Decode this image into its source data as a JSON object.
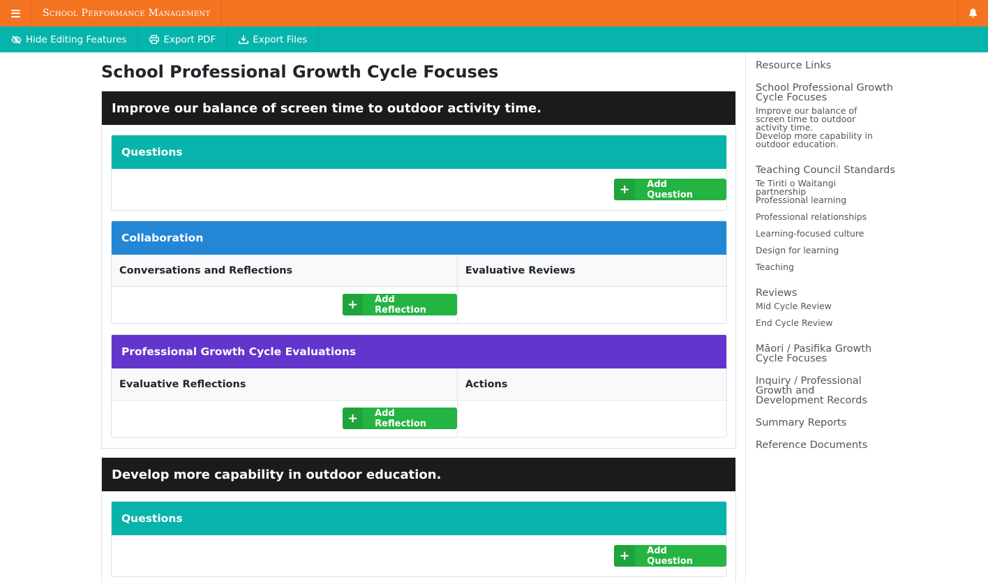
{
  "app": {
    "title": "School Performance Management"
  },
  "toolbar": {
    "hide_editing": "Hide Editing Features",
    "export_pdf": "Export PDF",
    "export_files": "Export Files"
  },
  "page": {
    "title": "School Professional Growth Cycle Focuses"
  },
  "focuses": [
    {
      "title": "Improve our balance of screen time to outdoor activity time.",
      "questions": {
        "header": "Questions",
        "button": "Add Question"
      },
      "collaboration": {
        "header": "Collaboration",
        "left_col": "Conversations and Reflections",
        "right_col": "Evaluative Reviews",
        "button": "Add Reflection"
      },
      "evaluations": {
        "header": "Professional Growth Cycle Evaluations",
        "left_col": "Evaluative Reflections",
        "right_col": "Actions",
        "button": "Add Reflection"
      }
    },
    {
      "title": "Develop more capability in outdoor education.",
      "questions": {
        "header": "Questions",
        "button": "Add Question"
      }
    }
  ],
  "sidebar": {
    "resource_links": "Resource Links",
    "growth_focuses": "School Professional Growth Cycle Focuses",
    "focus_1": "Improve our balance of screen time to outdoor activity time.",
    "focus_2": "Develop more capability in outdoor education.",
    "standards": "Teaching Council Standards",
    "standards_items": [
      "Te Tiriti o Waitangi partnership",
      "Professional learning",
      "Professional relationships",
      "Learning-focused culture",
      "Design for learning",
      "Teaching"
    ],
    "reviews": "Reviews",
    "reviews_items": [
      "Mid Cycle Review",
      "End Cycle Review"
    ],
    "maori_pasifika": "Māori / Pasifika Growth Cycle Focuses",
    "inquiry": "Inquiry / Professional Growth and Development Records",
    "summary": "Summary Reports",
    "reference": "Reference Documents"
  },
  "icons": {
    "menu": "hamburger-icon",
    "bell": "bell-icon",
    "hide": "eye-slash-icon",
    "pdf": "printer-icon",
    "files": "download-icon",
    "plus": "plus-icon"
  },
  "colors": {
    "topbar": "#f47321",
    "toolbar": "#06b4ac",
    "questions": "#06b4ac",
    "collaboration": "#2487d6",
    "evaluations": "#6236cc",
    "focus_header": "#1b1b1d",
    "add_button": "#23b442"
  }
}
